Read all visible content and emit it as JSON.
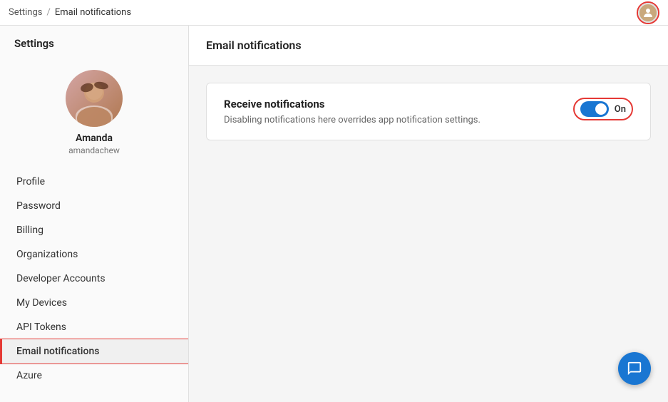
{
  "topbar": {
    "breadcrumb_root": "Settings",
    "breadcrumb_sep": "/",
    "breadcrumb_current": "Email notifications"
  },
  "sidebar": {
    "title": "Settings",
    "user": {
      "display_name": "Amanda",
      "username": "amandachew"
    },
    "nav_items": [
      {
        "id": "profile",
        "label": "Profile",
        "active": false
      },
      {
        "id": "password",
        "label": "Password",
        "active": false
      },
      {
        "id": "billing",
        "label": "Billing",
        "active": false
      },
      {
        "id": "organizations",
        "label": "Organizations",
        "active": false
      },
      {
        "id": "developer-accounts",
        "label": "Developer Accounts",
        "active": false
      },
      {
        "id": "my-devices",
        "label": "My Devices",
        "active": false
      },
      {
        "id": "api-tokens",
        "label": "API Tokens",
        "active": false
      },
      {
        "id": "email-notifications",
        "label": "Email notifications",
        "active": true
      },
      {
        "id": "azure",
        "label": "Azure",
        "active": false
      }
    ]
  },
  "content": {
    "header_title": "Email notifications",
    "notification_card": {
      "heading": "Receive notifications",
      "description": "Disabling notifications here overrides app notification settings.",
      "toggle_state": "On",
      "toggle_on": true
    }
  }
}
